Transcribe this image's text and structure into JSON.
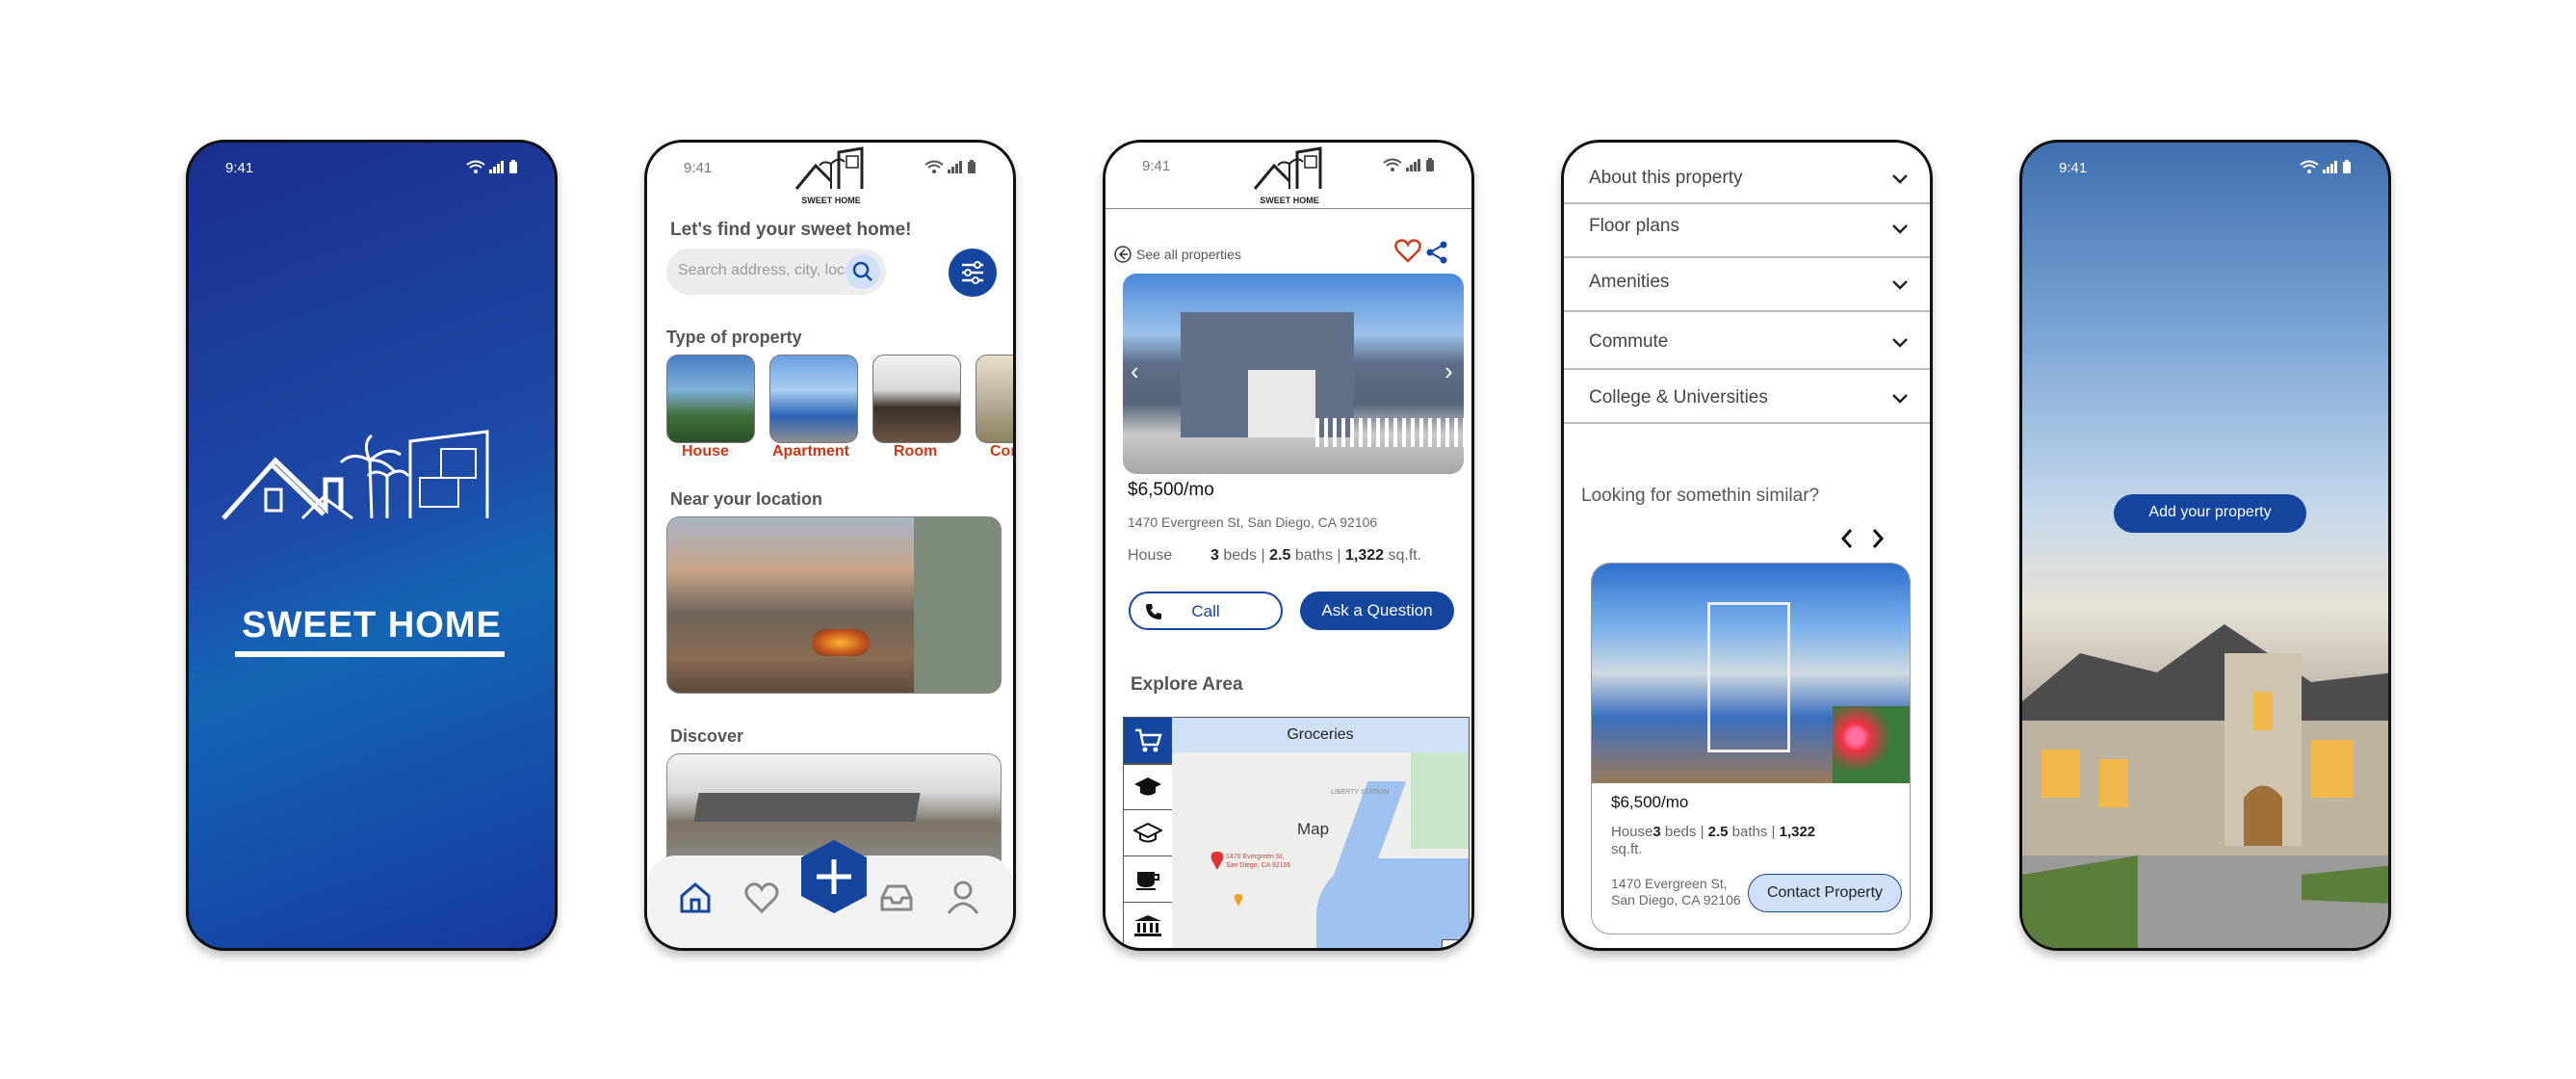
{
  "status": {
    "time": "9:41"
  },
  "splash": {
    "brand": "SWEET HOME"
  },
  "logo_small": "SWEET HOME",
  "home": {
    "heading": "Let's find your sweet home!",
    "search_placeholder": "Search address, city, location",
    "type_heading": "Type of property",
    "types": [
      "House",
      "Apartment",
      "Room",
      "Con"
    ],
    "near_heading": "Near your location",
    "discover_heading": "Discover"
  },
  "detail": {
    "back_label": "See all properties",
    "price": "$6,500/mo",
    "address": "1470 Evergreen St, San Diego, CA 92106",
    "type": "House",
    "beds_num": "3",
    "beds_label": "beds |",
    "baths_num": "2.5",
    "baths_label": "baths |",
    "sqft_num": "1,322",
    "sqft_label": "sq.ft.",
    "call_label": "Call",
    "ask_label": "Ask a Question",
    "explore_heading": "Explore Area",
    "map_tab": "Groceries",
    "map_label": "Map",
    "map_pin_text": "1470 Evergreen St, San Diego, CA 92106",
    "map_street": "LIBERTY STATION"
  },
  "about": {
    "sections": [
      "About this property",
      "Floor plans",
      "Amenities",
      "Commute",
      "College & Universities"
    ],
    "similar_heading": "Looking for somethin similar?",
    "card": {
      "price": "$6,500/mo",
      "type": "House",
      "beds_num": "3",
      "beds_label": "beds |",
      "baths_num": "2.5",
      "baths_label": "baths |",
      "sqft_num": "1,322",
      "sqft_label": "sq.ft.",
      "address": "1470 Evergreen St, San Diego, CA 92106",
      "contact_label": "Contact Property"
    }
  },
  "add": {
    "button_label": "Add your property"
  },
  "colors": {
    "primary": "#1446a0",
    "accent": "#c93a14",
    "light_blue": "#cfe0f7"
  }
}
